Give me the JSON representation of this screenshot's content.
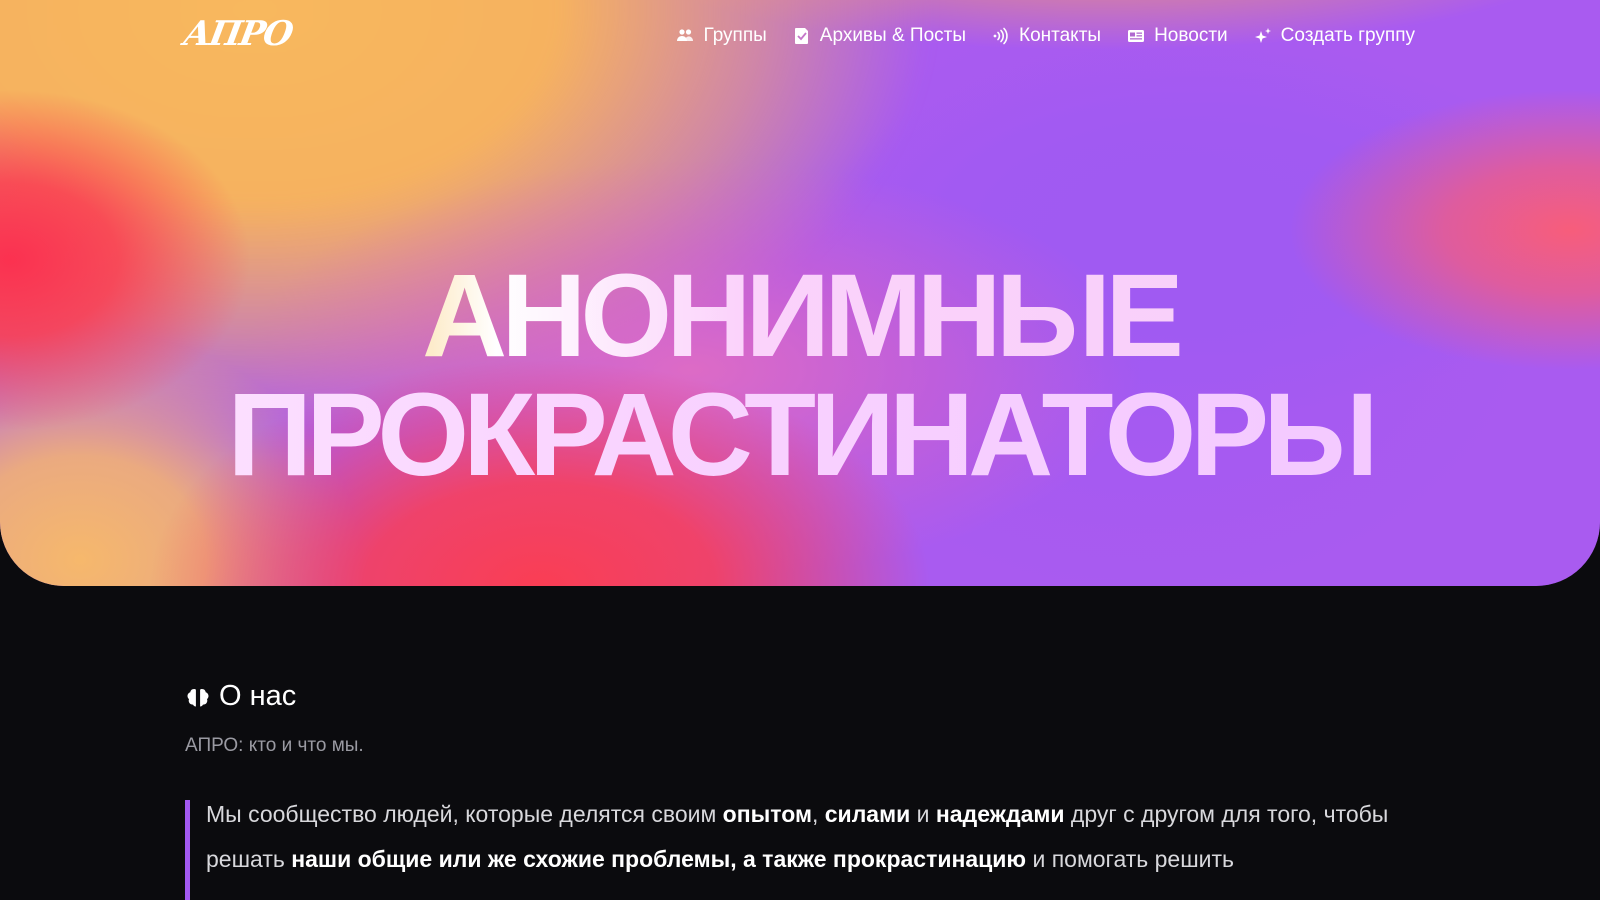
{
  "header": {
    "logo_text": "АПРО",
    "nav": [
      {
        "label": "Группы",
        "icon": "groups-icon"
      },
      {
        "label": "Архивы & Посты",
        "icon": "archive-icon"
      },
      {
        "label": "Контакты",
        "icon": "contact-signal-icon"
      },
      {
        "label": "Новости",
        "icon": "newspaper-icon"
      },
      {
        "label": "Создать группу",
        "icon": "sparkles-icon"
      }
    ]
  },
  "hero": {
    "title_line1": "АНОНИМНЫЕ",
    "title_line2": "ПРОКРАСТИНАТОРЫ"
  },
  "about": {
    "icon": "brain-icon",
    "title": "О нас",
    "subtitle": "АПРО: кто и что мы.",
    "quote": {
      "p1": "Мы сообщество людей, которые делятся своим ",
      "b1": "опытом",
      "p2": ", ",
      "b2": "силами",
      "p3": " и ",
      "b3": "надеждами",
      "p4": " друг с другом для того, чтобы решать ",
      "b4": "наши общие или же схожие проблемы, а также прокрастинацию",
      "p5": " и помогать решить"
    }
  },
  "colors": {
    "page_background": "#0b0b0e",
    "accent_violet": "#a259f0",
    "hero_orange": "#f6b25f",
    "hero_red": "#fb3150",
    "hero_violet": "#a95bf0"
  }
}
